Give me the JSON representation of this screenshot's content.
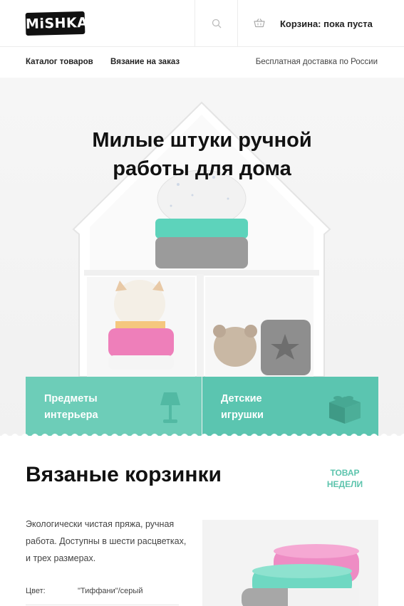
{
  "header": {
    "logo_text": "MiSHKA",
    "cart_label": "Корзина: пока пуста",
    "search_icon": "search-icon",
    "cart_icon": "basket-icon"
  },
  "nav": {
    "items": [
      {
        "label": "Каталог товаров"
      },
      {
        "label": "Вязание на заказ"
      }
    ],
    "delivery_note": "Бесплатная доставка по России"
  },
  "hero": {
    "title_line1": "Милые штуки ручной",
    "title_line2": "работы для дома"
  },
  "categories": [
    {
      "label": "Предметы интерьера",
      "icon": "lamp-icon",
      "color": "#6dcdb8"
    },
    {
      "label": "Детские игрушки",
      "icon": "toy-block-icon",
      "color": "#5bc5b0"
    }
  ],
  "product": {
    "title": "Вязаные корзинки",
    "badge": "Товар недели",
    "description": "Экологически чистая пряжа, ручная работа. Доступны в шести расцветках, и трех размерах.",
    "color_label": "Цвет:",
    "color_value": "\"Тиффани\"/серый"
  },
  "colors": {
    "accent": "#6dcdb8",
    "accent_dark": "#5bc5b0",
    "badge_text": "#5dc4ad"
  }
}
